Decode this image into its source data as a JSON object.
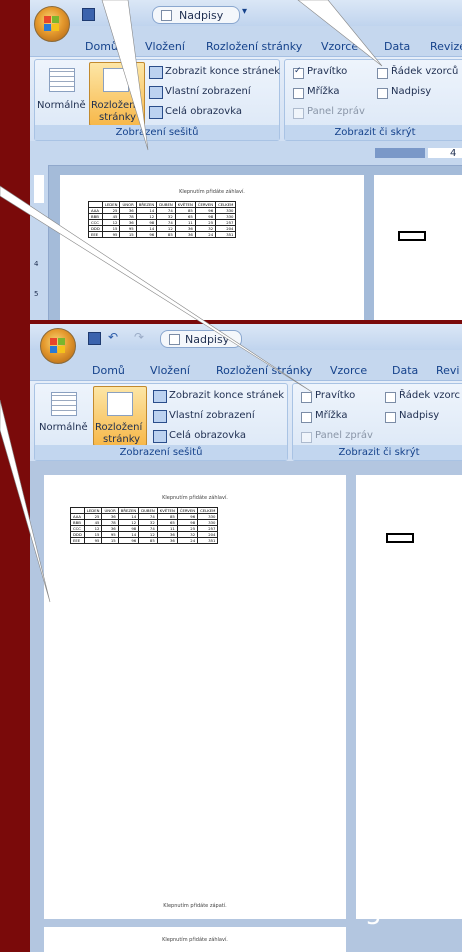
{
  "top": {
    "quick_access": "Nadpisy",
    "tabs": [
      "Domů",
      "Vložení",
      "Rozložení stránky",
      "Vzorce",
      "Data",
      "Revize"
    ],
    "groups": {
      "views": {
        "label": "Zobrazení sešitů",
        "normal": "Normálně",
        "layout_line1": "Rozložení",
        "layout_line2": "stránky",
        "page_break": "Zobrazit konce stránek",
        "custom": "Vlastní zobrazení",
        "full_screen": "Celá obrazovka"
      },
      "show_hide": {
        "label": "Zobrazit či skrýt",
        "ruler": "Pravítko",
        "formula_bar": "Řádek vzorců",
        "gridlines": "Mřížka",
        "headings": "Nadpisy",
        "message_bar": "Panel zpráv",
        "ruler_checked": true
      }
    },
    "ruler_number": "4",
    "side_rows": [
      "4",
      "5"
    ],
    "page_title": "Klepnutím přidáte záhlaví."
  },
  "bottom": {
    "quick_access": "Nadpisy",
    "tabs": [
      "Domů",
      "Vložení",
      "Rozložení stránky",
      "Vzorce",
      "Data",
      "Revi"
    ],
    "groups": {
      "views": {
        "label": "Zobrazení sešitů",
        "normal": "Normálně",
        "layout_line1": "Rozložení",
        "layout_line2": "stránky",
        "page_break": "Zobrazit konce stránek",
        "custom": "Vlastní zobrazení",
        "full_screen": "Celá obrazovka"
      },
      "show_hide": {
        "label": "Zobrazit či skrýt",
        "ruler": "Pravítko",
        "formula_bar": "Řádek vzorc",
        "gridlines": "Mřížka",
        "headings": "Nadpisy",
        "message_bar": "Panel zpráv",
        "ruler_checked": false
      }
    },
    "page_header": "Klepnutím přidáte záhlaví.",
    "page_footer": "Klepnutím přidáte zápatí.",
    "next_page_header": "Klepnutím přidáte záhlaví."
  },
  "table": {
    "headers": [
      "",
      "LEDEN",
      "ÚNOR",
      "BŘEZEN",
      "DUBEN",
      "KVĚTEN",
      "ČERVEN",
      "CELKEM"
    ],
    "rows": [
      [
        "AAA",
        "25",
        "36",
        "14",
        "74",
        "85",
        "96",
        "330"
      ],
      [
        "BBB",
        "45",
        "78",
        "12",
        "32",
        "65",
        "98",
        "330"
      ],
      [
        "CCC",
        "12",
        "36",
        "98",
        "74",
        "11",
        "25",
        "257"
      ],
      [
        "DDD",
        "15",
        "95",
        "14",
        "12",
        "36",
        "32",
        "204"
      ],
      [
        "EEE",
        "95",
        "15",
        "96",
        "85",
        "36",
        "24",
        "351"
      ]
    ]
  },
  "slide_number": "5"
}
